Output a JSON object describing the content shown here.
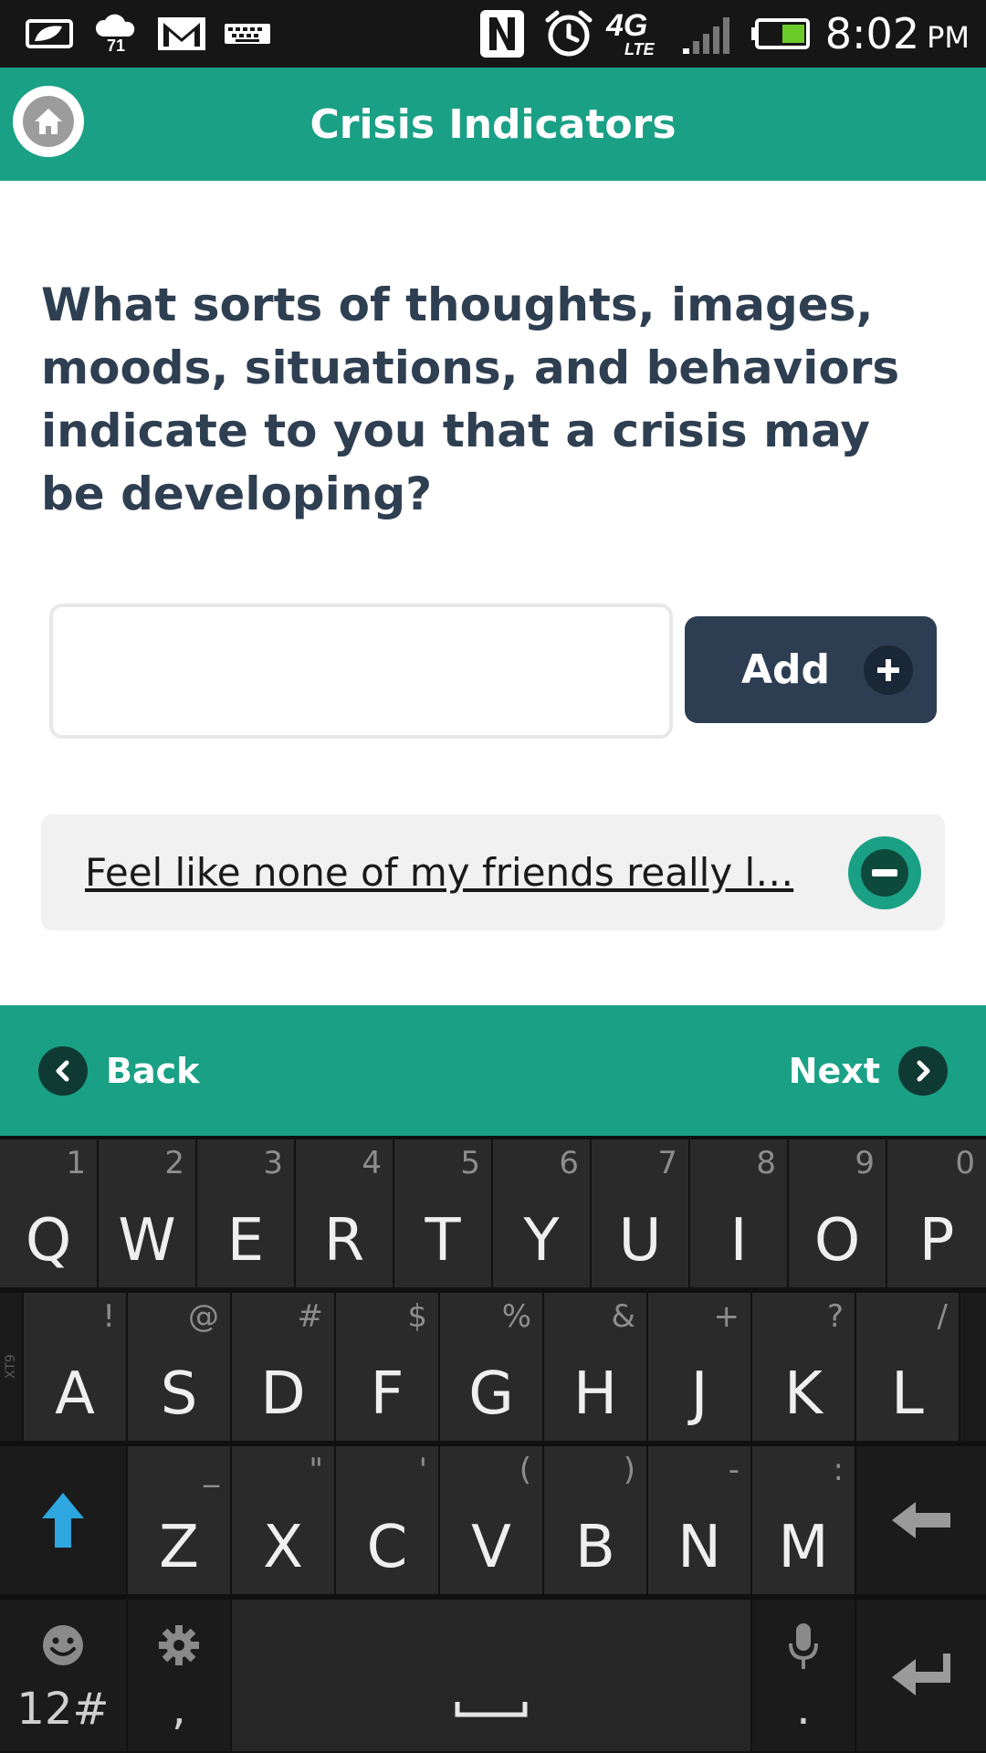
{
  "status_bar": {
    "temperature": "71",
    "network_label": "4G",
    "network_sub": "LTE",
    "time": "8:02",
    "ampm": "PM",
    "icons": [
      "leaf-notification-icon",
      "weather-icon",
      "gmail-icon",
      "keyboard-icon",
      "nfc-icon",
      "alarm-icon",
      "network-4g-lte-icon",
      "signal-icon",
      "battery-icon"
    ]
  },
  "header": {
    "title": "Crisis Indicators",
    "home_icon": "home-icon"
  },
  "question": "What sorts of thoughts, images, moods, situations, and behaviors indicate to you that a crisis may be developing?",
  "entry": {
    "value": "",
    "placeholder": ""
  },
  "add_button": {
    "label": "Add",
    "icon": "plus-icon"
  },
  "indicators": [
    {
      "text": "Feel like none of my friends really l…",
      "remove_icon": "minus-icon"
    }
  ],
  "footer": {
    "back_label": "Back",
    "next_label": "Next"
  },
  "keyboard": {
    "row1": [
      {
        "key": "Q",
        "alt": "1"
      },
      {
        "key": "W",
        "alt": "2"
      },
      {
        "key": "E",
        "alt": "3"
      },
      {
        "key": "R",
        "alt": "4"
      },
      {
        "key": "T",
        "alt": "5"
      },
      {
        "key": "Y",
        "alt": "6"
      },
      {
        "key": "U",
        "alt": "7"
      },
      {
        "key": "I",
        "alt": "8"
      },
      {
        "key": "O",
        "alt": "9"
      },
      {
        "key": "P",
        "alt": "0"
      }
    ],
    "row2": [
      {
        "key": "A",
        "alt": "!"
      },
      {
        "key": "S",
        "alt": "@"
      },
      {
        "key": "D",
        "alt": "#"
      },
      {
        "key": "F",
        "alt": "$"
      },
      {
        "key": "G",
        "alt": "%"
      },
      {
        "key": "H",
        "alt": "&"
      },
      {
        "key": "J",
        "alt": "+"
      },
      {
        "key": "K",
        "alt": "?"
      },
      {
        "key": "L",
        "alt": "/"
      }
    ],
    "row3": [
      {
        "key": "Z",
        "alt": "_"
      },
      {
        "key": "X",
        "alt": "\""
      },
      {
        "key": "C",
        "alt": "'"
      },
      {
        "key": "V",
        "alt": "("
      },
      {
        "key": "B",
        "alt": ")"
      },
      {
        "key": "N",
        "alt": "-"
      },
      {
        "key": "M",
        "alt": ":"
      }
    ],
    "xt9_label": "XT9",
    "symbols_label": "12#",
    "comma_label": ",",
    "period_label": ".",
    "accent_color": "#2ea7e0"
  }
}
